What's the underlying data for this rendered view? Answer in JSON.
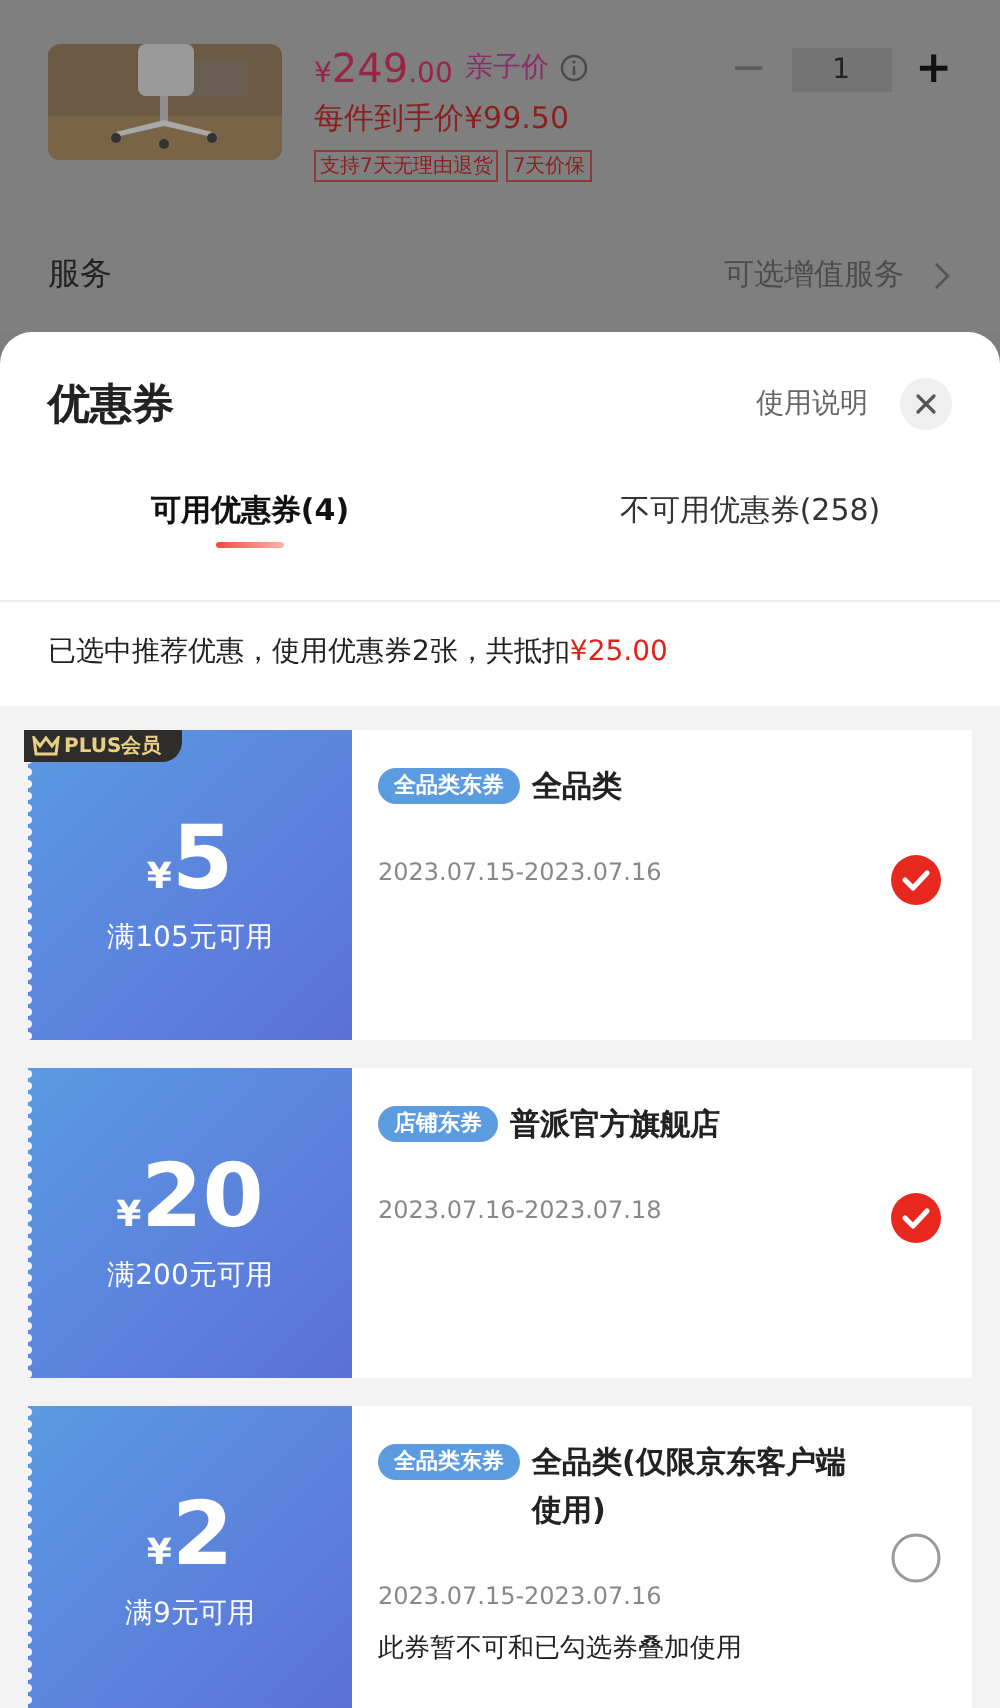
{
  "product": {
    "currency": "¥",
    "price_int": "249",
    "price_dec": ".00",
    "price_label": "亲子价",
    "final_price": "每件到手价¥99.50",
    "tags": [
      "支持7天无理由退货",
      "7天价保"
    ],
    "minus": "−",
    "quantity": "1",
    "plus": "+"
  },
  "service": {
    "label": "服务",
    "value": "可选增值服务"
  },
  "sheet": {
    "title": "优惠券",
    "help": "使用说明",
    "tabs": [
      {
        "label": "可用优惠券(4)",
        "selected": true
      },
      {
        "label": "不可用优惠券(258)",
        "selected": false
      }
    ],
    "summary_text": "已选中推荐优惠，使用优惠券2张，共抵扣",
    "summary_amount": "¥25.00",
    "coupons": [
      {
        "badge": "PLUS会员",
        "currency": "¥",
        "amount": "5",
        "condition": "满105元可用",
        "tag": "全品类东券",
        "title": "全品类",
        "dates": "2023.07.15-2023.07.16",
        "selected": true
      },
      {
        "currency": "¥",
        "amount": "20",
        "condition": "满200元可用",
        "tag": "店铺东券",
        "title": "普派官方旗舰店",
        "dates": "2023.07.16-2023.07.18",
        "selected": true
      },
      {
        "currency": "¥",
        "amount": "2",
        "condition": "满9元可用",
        "tag": "全品类东券",
        "title": "全品类(仅限京东客户端使用)",
        "dates": "2023.07.15-2023.07.16",
        "note": "此券暂不可和已勾选券叠加使用",
        "selected": false
      }
    ]
  }
}
